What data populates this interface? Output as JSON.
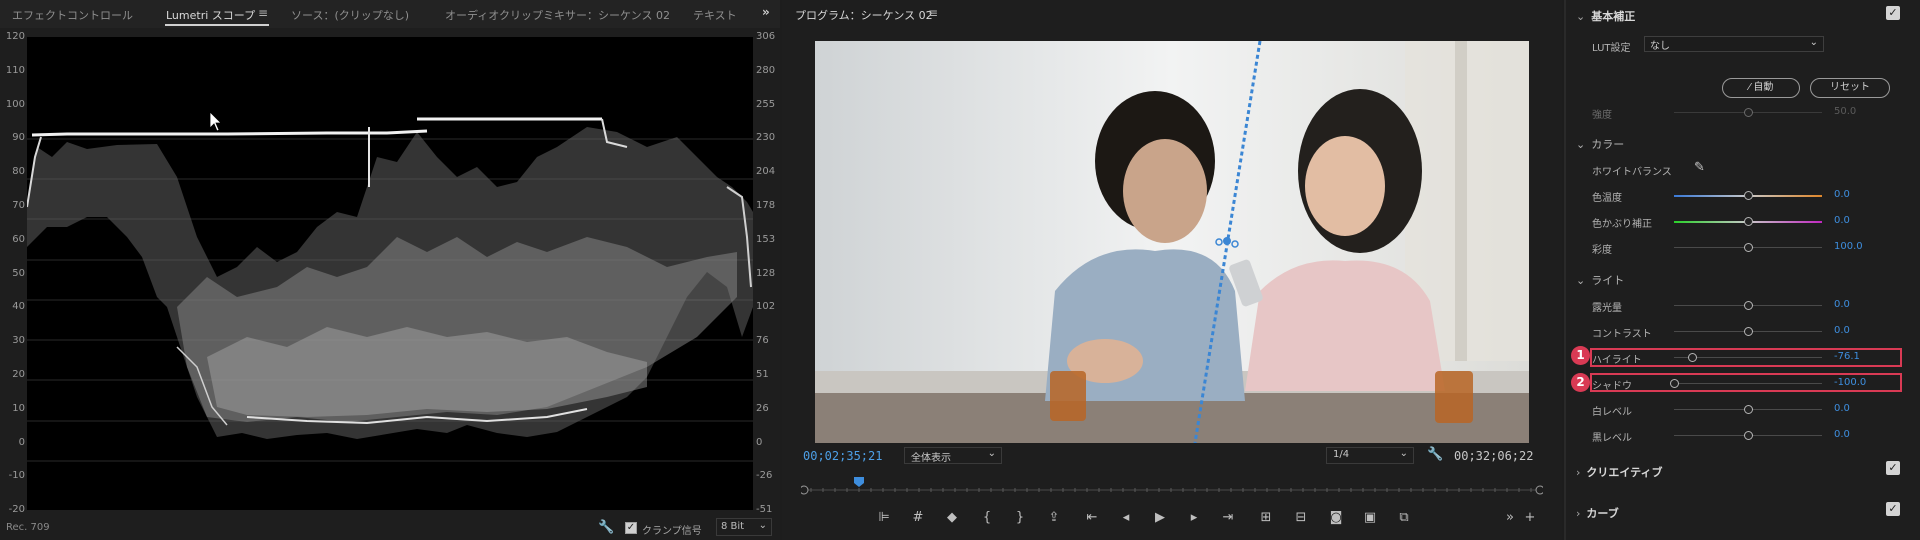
{
  "left_tabs": [
    {
      "label": "エフェクトコントロール"
    },
    {
      "label": "Lumetri スコープ"
    },
    {
      "label": "ソース：(クリップなし)"
    },
    {
      "label": "オーディオクリップミキサー：シーケンス 02"
    },
    {
      "label": "テキスト"
    }
  ],
  "scope": {
    "left_axis": [
      "120",
      "110",
      "100",
      "90",
      "80",
      "70",
      "60",
      "50",
      "40",
      "30",
      "20",
      "10",
      "0",
      "-10",
      "-20"
    ],
    "right_axis": [
      "306",
      "280",
      "255",
      "230",
      "204",
      "178",
      "153",
      "128",
      "102",
      "76",
      "51",
      "26",
      "0",
      "-26",
      "-51"
    ],
    "standard": "Rec. 709",
    "clamp_label": "クランプ信号",
    "clamp_checked": true,
    "bit_depth": "8 Bit"
  },
  "program": {
    "title": "プログラム：シーケンス 02",
    "timecode_current": "00;02;35;21",
    "fit": "全体表示",
    "resolution": "1/4",
    "timecode_duration": "00;32;06;22"
  },
  "transport_icons": [
    "marker-in-icon",
    "safe-margins-icon",
    "add-marker-icon",
    "mark-in-icon",
    "mark-out-icon",
    "export-frame-icon",
    "go-to-in-icon",
    "step-back-icon",
    "play-icon",
    "step-forward-icon",
    "go-to-out-icon",
    "lift-icon",
    "extract-icon",
    "camera-icon",
    "compare-icon",
    "multi-camera-icon",
    "more-icon",
    "add-icon"
  ],
  "lumetri": {
    "basic_correction": "基本補正",
    "lut_label": "LUT設定",
    "lut_value": "なし",
    "auto_button": "自動",
    "reset_button": "リセット",
    "intensity_label": "強度",
    "intensity_value": "50.0",
    "color_section": "カラー",
    "white_balance": "ホワイトバランス",
    "sliders_color": [
      {
        "label": "色温度",
        "value": "0.0",
        "pos": 0.5
      },
      {
        "label": "色かぶり補正",
        "value": "0.0",
        "pos": 0.5
      },
      {
        "label": "彩度",
        "value": "100.0",
        "pos": 0.5
      }
    ],
    "light_section": "ライト",
    "sliders_light": [
      {
        "label": "露光量",
        "value": "0.0",
        "pos": 0.5
      },
      {
        "label": "コントラスト",
        "value": "0.0",
        "pos": 0.5
      },
      {
        "label": "ハイライト",
        "value": "-76.1",
        "pos": 0.12
      },
      {
        "label": "シャドウ",
        "value": "-100.0",
        "pos": 0.0
      },
      {
        "label": "白レベル",
        "value": "0.0",
        "pos": 0.5
      },
      {
        "label": "黒レベル",
        "value": "0.0",
        "pos": 0.5
      }
    ],
    "badges": [
      "1",
      "2"
    ],
    "creative_section": "クリエイティブ",
    "curves_section": "カーブ",
    "colors": {
      "accent": "#3e8ede",
      "highlight_box": "#d93a54"
    }
  }
}
